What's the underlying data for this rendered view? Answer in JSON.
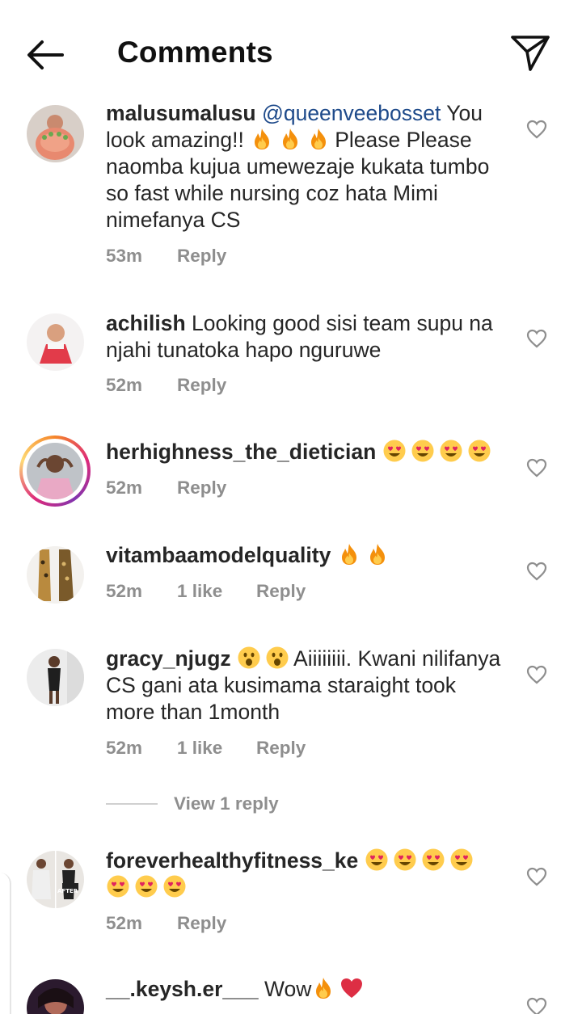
{
  "header": {
    "title": "Comments",
    "back_icon": "arrow-left-icon",
    "share_icon": "paper-plane-icon"
  },
  "colors": {
    "text": "#262626",
    "meta": "#8e8e8e",
    "mention": "#1e4a8a",
    "story_ring": [
      "#f58529",
      "#dd2a7b",
      "#8134af"
    ]
  },
  "comments": [
    {
      "username": "malusumalusu",
      "mention": "@queenveebosset",
      "text_a": " You look amazing!! ",
      "text_b": "Please Please naomba kujua umewezaje kukata tumbo so fast while nursing coz hata Mimi nimefanya CS",
      "emojis": [
        "fire",
        "fire",
        "fire"
      ],
      "time": "53m",
      "reply": "Reply"
    },
    {
      "username": "achilish",
      "text": " Looking good sisi team supu na njahi tunatoka hapo nguruwe",
      "time": "52m",
      "reply": "Reply"
    },
    {
      "username": "herhighness_the_dietician",
      "emojis": [
        "heart-eyes",
        "heart-eyes",
        "heart-eyes",
        "heart-eyes"
      ],
      "time": "52m",
      "reply": "Reply",
      "has_story": true
    },
    {
      "username": "vitambaamodelquality",
      "emojis": [
        "fire",
        "fire"
      ],
      "time": "52m",
      "likes": "1 like",
      "reply": "Reply"
    },
    {
      "username": "gracy_njugz",
      "emojis": [
        "astonished",
        "astonished"
      ],
      "text": "Aiiiiiiii. Kwani nilifanya CS gani ata kusimama staraight took more than 1month",
      "time": "52m",
      "likes": "1 like",
      "reply": "Reply",
      "view_replies": "View 1 reply"
    },
    {
      "username": "foreverhealthyfitness_ke",
      "emojis": [
        "heart-eyes",
        "heart-eyes",
        "heart-eyes",
        "heart-eyes",
        "heart-eyes",
        "heart-eyes",
        "heart-eyes"
      ],
      "avatar_text": "AFTER",
      "time": "52m",
      "reply": "Reply"
    },
    {
      "username": "__.keysh.er___",
      "text": " Wow",
      "emojis": [
        "fire",
        "red-heart"
      ]
    }
  ]
}
